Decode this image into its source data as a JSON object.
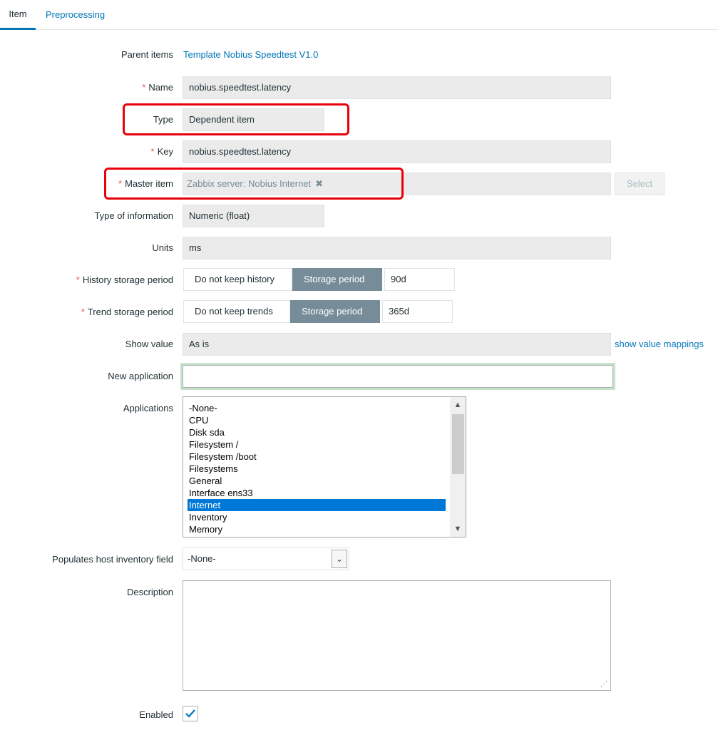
{
  "tabs": {
    "item": "Item",
    "preprocessing": "Preprocessing"
  },
  "form": {
    "parent_items": {
      "label": "Parent items",
      "value": "Template Nobius Speedtest V1.0"
    },
    "name": {
      "label": "Name",
      "required_mark": "*",
      "value": "nobius.speedtest.latency"
    },
    "type": {
      "label": "Type",
      "value": "Dependent item"
    },
    "key": {
      "label": "Key",
      "required_mark": "*",
      "value": "nobius.speedtest.latency"
    },
    "master_item": {
      "label": "Master item",
      "required_mark": "*",
      "chip": "Zabbix server: Nobius Internet",
      "chip_remove": "✖",
      "select_button": "Select"
    },
    "type_of_information": {
      "label": "Type of information",
      "value": "Numeric (float)"
    },
    "units": {
      "label": "Units",
      "value": "ms"
    },
    "history": {
      "label": "History storage period",
      "required_mark": "*",
      "option_off": "Do not keep history",
      "option_on": "Storage period",
      "value": "90d"
    },
    "trend": {
      "label": "Trend storage period",
      "required_mark": "*",
      "option_off": "Do not keep trends",
      "option_on": "Storage period",
      "value": "365d"
    },
    "show_value": {
      "label": "Show value",
      "value": "As is",
      "mappings_link": "show value mappings"
    },
    "new_application": {
      "label": "New application",
      "value": ""
    },
    "applications": {
      "label": "Applications",
      "options": [
        "-None-",
        "CPU",
        "Disk sda",
        "Filesystem /",
        "Filesystem /boot",
        "Filesystems",
        "General",
        "Interface ens33",
        "Internet",
        "Inventory",
        "Memory"
      ],
      "selected": "Internet"
    },
    "inventory_field": {
      "label": "Populates host inventory field",
      "value": "-None-"
    },
    "description": {
      "label": "Description",
      "value": ""
    },
    "enabled": {
      "label": "Enabled",
      "checked": true
    }
  },
  "colors": {
    "accent": "#0275b8",
    "required": "#e45959",
    "highlight_box": "#e8000b",
    "selected_row": "#0078d7"
  }
}
